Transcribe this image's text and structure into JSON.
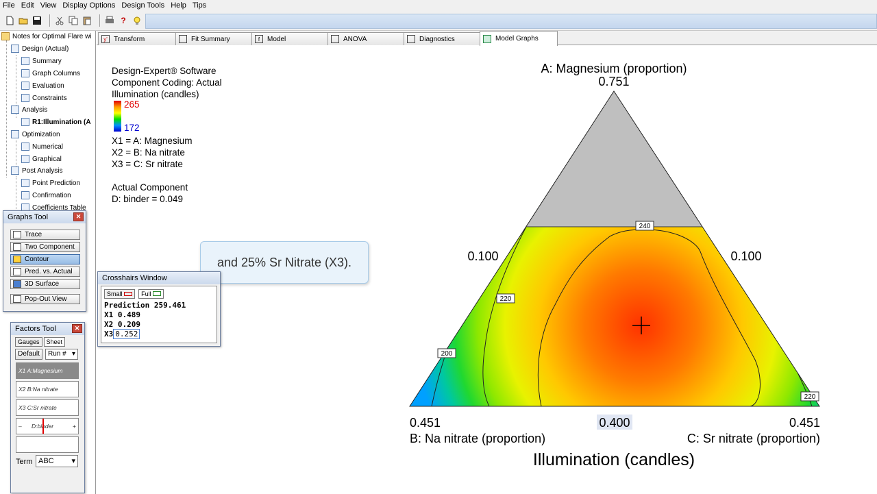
{
  "menu": [
    "File",
    "Edit",
    "View",
    "Display Options",
    "Design Tools",
    "Help",
    "Tips"
  ],
  "toolbar": {
    "icons": [
      "new-file-icon",
      "open-folder-icon",
      "save-icon",
      "cut-icon",
      "copy-icon",
      "paste-icon",
      "print-icon",
      "help-icon",
      "tip-bulb-icon"
    ]
  },
  "tree": {
    "root": "Notes for Optimal Flare wi",
    "design": "Design (Actual)",
    "summary": "Summary",
    "graph_columns": "Graph Columns",
    "evaluation": "Evaluation",
    "constraints": "Constraints",
    "analysis": "Analysis",
    "r1": "R1:Illumination (A",
    "optimization": "Optimization",
    "numerical": "Numerical",
    "graphical": "Graphical",
    "post_analysis": "Post Analysis",
    "point_prediction": "Point Prediction",
    "confirmation": "Confirmation",
    "coefficients_table": "Coefficients Table"
  },
  "tabs": [
    "Transform",
    "Fit Summary",
    "Model",
    "ANOVA",
    "Diagnostics",
    "Model Graphs"
  ],
  "legend": {
    "software": "Design-Expert® Software",
    "coding": "Component Coding: Actual",
    "response": "Illumination (candles)",
    "max": "265",
    "min": "172",
    "x1": "X1 = A: Magnesium",
    "x2": "X2 = B: Na nitrate",
    "x3": "X3 = C: Sr nitrate",
    "actual_component": "Actual Component",
    "binder": "D: binder = 0.049"
  },
  "ternary": {
    "top_axis": "A: Magnesium (proportion)",
    "top_value": "0.751",
    "left_value": "0.100",
    "right_value": "0.100",
    "bottom_left_value": "0.451",
    "bottom_center_value": "0.400",
    "bottom_right_value": "0.451",
    "bottom_left_axis": "B: Na nitrate (proportion)",
    "bottom_right_axis": "C: Sr nitrate (proportion)",
    "title": "Illumination (candles)",
    "contour_labels": [
      "240",
      "220",
      "200",
      "220"
    ]
  },
  "callout": "and 25% Sr Nitrate (X3).",
  "graphs_tool": {
    "title": "Graphs Tool",
    "buttons": [
      "Trace",
      "Two Component",
      "Contour",
      "Pred. vs. Actual",
      "3D Surface",
      "Pop-Out View"
    ]
  },
  "crosshairs": {
    "title": "Crosshairs Window",
    "small": "Small",
    "full": "Full",
    "prediction": "Prediction 259.461",
    "x1": "X1 0.489",
    "x2": "X2 0.209",
    "x3_label": "X3",
    "x3_value": "0.252"
  },
  "factors_tool": {
    "title": "Factors Tool",
    "gauges": "Gauges",
    "sheet": "Sheet",
    "default": "Default",
    "run": "Run #",
    "rows": [
      "X1  A:Magnesium",
      "X2  B:Na nitrate",
      "X3  C:Sr nitrate"
    ],
    "binder": "D:binder",
    "minus": "–",
    "plus": "+",
    "term_label": "Term",
    "term_value": "ABC"
  },
  "colors": {
    "accent": "#3a6aa8",
    "contour_high": "#e00000",
    "contour_low": "#0000d0"
  }
}
